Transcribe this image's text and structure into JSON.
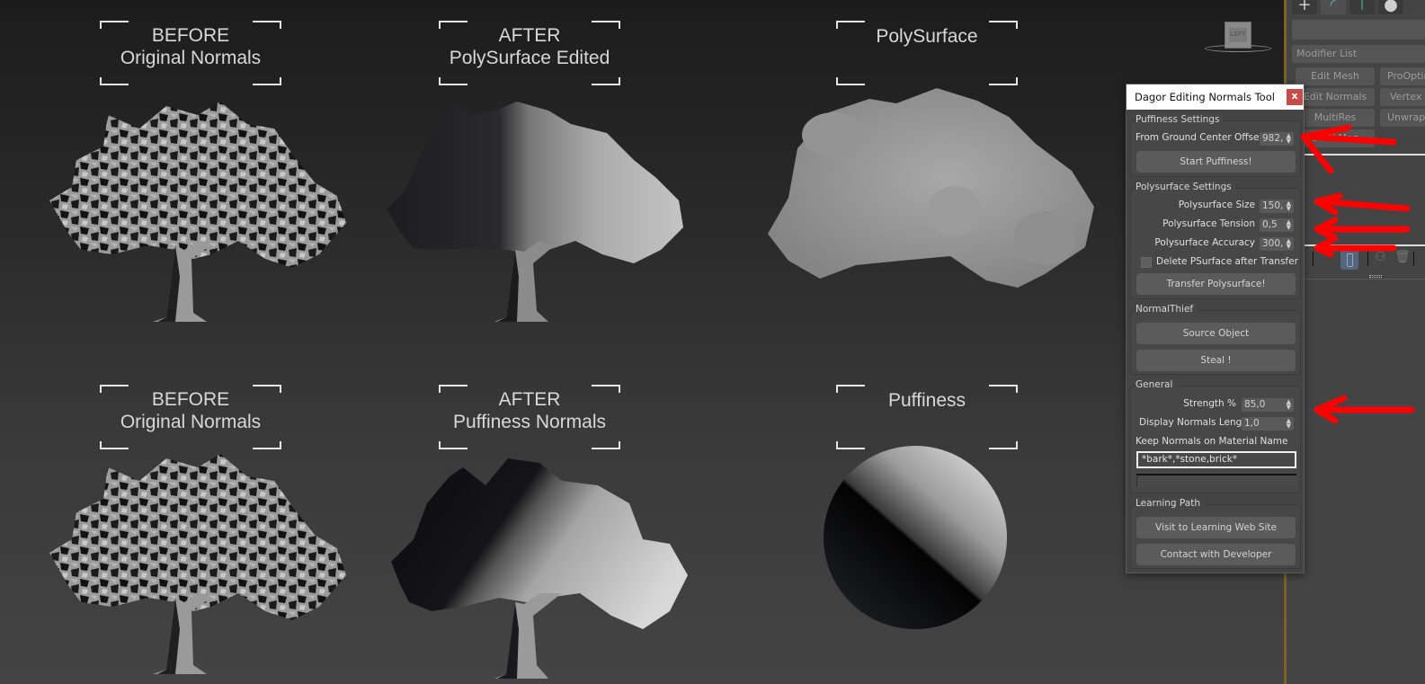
{
  "viewport": {
    "labels": [
      {
        "line1": "BEFORE",
        "line2": "Original Normals"
      },
      {
        "line1": "AFTER",
        "line2": "PolySurface Edited"
      },
      {
        "line1": "PolySurface",
        "line2": ""
      },
      {
        "line1": "BEFORE",
        "line2": "Original Normals"
      },
      {
        "line1": "AFTER",
        "line2": "Puffiness Normals"
      },
      {
        "line1": "Puffiness",
        "line2": ""
      }
    ],
    "viewcube_label": "LEFT",
    "objects": [
      "tree-original-normals-top",
      "tree-polysurface-edited",
      "polysurface-blob",
      "tree-original-normals-bottom",
      "tree-puffiness-normals",
      "puffiness-sphere"
    ]
  },
  "command_panel": {
    "tabs": [
      {
        "icon": "create-icon",
        "glyph": "+"
      },
      {
        "icon": "modify-icon",
        "glyph": "◜"
      },
      {
        "icon": "hierarchy-icon",
        "glyph": "⊤"
      },
      {
        "icon": "motion-icon",
        "glyph": "●"
      }
    ],
    "modifier_list": "Modifier List",
    "modifier_buttons": [
      "Edit Mesh",
      "ProOptimizer",
      "Edit Normals",
      "Vertex Weld",
      "MultiRes",
      "Unwrap UVW",
      "UVW Map"
    ]
  },
  "dialog": {
    "title": "Dagor Editing Normals Tool",
    "close_label": "x",
    "puffiness": {
      "title": "Puffiness Settings",
      "offset_label": "From Ground Center Offset",
      "offset_value": "982,",
      "start_button": "Start Puffiness!"
    },
    "polysurface": {
      "title": "Polysurface Settings",
      "size_label": "Polysurface Size",
      "size_value": "150,",
      "tension_label": "Polysurface Tension",
      "tension_value": "0,5",
      "accuracy_label": "Polysurface Accuracy",
      "accuracy_value": "300,",
      "delete_label": "Delete PSurface after Transfer",
      "delete_checked": false,
      "transfer_button": "Transfer Polysurface!"
    },
    "normal_thief": {
      "title": "NormalThief",
      "source_button": "Source Object",
      "steal_button": "Steal !"
    },
    "general": {
      "title": "General",
      "strength_label": "Strength %",
      "strength_value": "85,0",
      "display_length_label": "Display Normals Length",
      "display_length_value": "1,0",
      "keep_normals_label": "Keep Normals on Material Name",
      "keep_normals_value": "*bark*,*stone,brick*",
      "progress": 0
    },
    "learning": {
      "title": "Learning Path",
      "visit_button": "Visit to Learning Web Site",
      "contact_button": "Contact with Developer"
    }
  },
  "colors": {
    "annotation_red": "#ff0000",
    "close_red": "#c74b4b",
    "viewport_border": "#7a6323",
    "active_tab": "#4fb4b4"
  }
}
